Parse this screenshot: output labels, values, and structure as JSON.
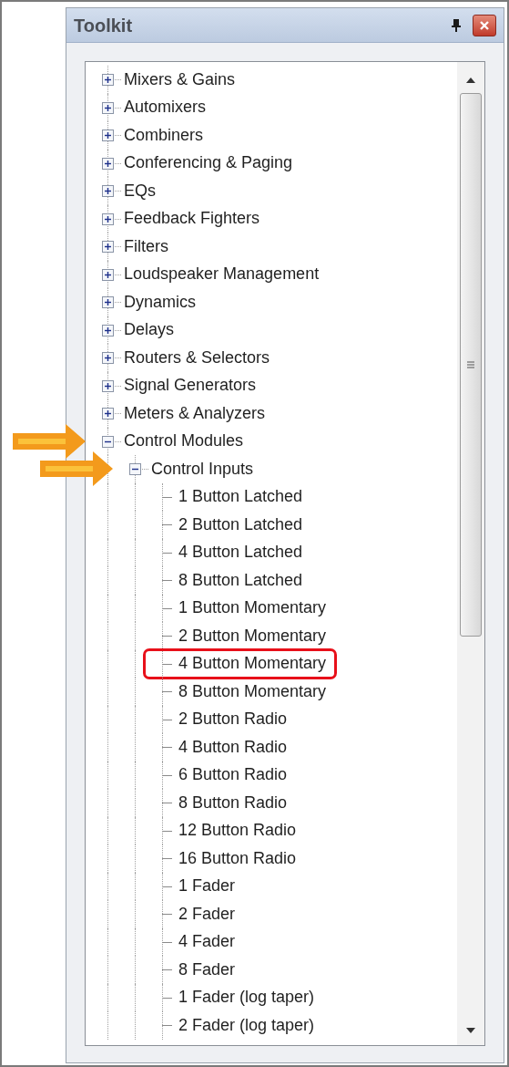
{
  "panel": {
    "title": "Toolkit"
  },
  "tree": [
    {
      "label": "Mixers & Gains",
      "expanded": false,
      "marked": false
    },
    {
      "label": "Automixers",
      "expanded": false,
      "marked": false
    },
    {
      "label": "Combiners",
      "expanded": false,
      "marked": false
    },
    {
      "label": "Conferencing & Paging",
      "expanded": false,
      "marked": false
    },
    {
      "label": "EQs",
      "expanded": false,
      "marked": false
    },
    {
      "label": "Feedback Fighters",
      "expanded": false,
      "marked": false
    },
    {
      "label": "Filters",
      "expanded": false,
      "marked": false
    },
    {
      "label": "Loudspeaker Management",
      "expanded": false,
      "marked": false
    },
    {
      "label": "Dynamics",
      "expanded": false,
      "marked": false
    },
    {
      "label": "Delays",
      "expanded": false,
      "marked": false
    },
    {
      "label": "Routers & Selectors",
      "expanded": false,
      "marked": false
    },
    {
      "label": "Signal Generators",
      "expanded": false,
      "marked": false
    },
    {
      "label": "Meters & Analyzers",
      "expanded": false,
      "marked": false
    },
    {
      "label": "Control Modules",
      "expanded": true,
      "marked": true,
      "children": [
        {
          "label": "Control Inputs",
          "expanded": true,
          "marked": true,
          "children": [
            {
              "label": "1 Button Latched",
              "highlighted": false
            },
            {
              "label": "2 Button Latched",
              "highlighted": false
            },
            {
              "label": "4 Button Latched",
              "highlighted": false
            },
            {
              "label": "8 Button Latched",
              "highlighted": false
            },
            {
              "label": "1 Button Momentary",
              "highlighted": false
            },
            {
              "label": "2 Button Momentary",
              "highlighted": false
            },
            {
              "label": "4 Button Momentary",
              "highlighted": true
            },
            {
              "label": "8 Button Momentary",
              "highlighted": false
            },
            {
              "label": "2 Button Radio",
              "highlighted": false
            },
            {
              "label": "4 Button Radio",
              "highlighted": false
            },
            {
              "label": "6 Button Radio",
              "highlighted": false
            },
            {
              "label": "8 Button Radio",
              "highlighted": false
            },
            {
              "label": "12 Button Radio",
              "highlighted": false
            },
            {
              "label": "16 Button Radio",
              "highlighted": false
            },
            {
              "label": "1 Fader",
              "highlighted": false
            },
            {
              "label": "2 Fader",
              "highlighted": false
            },
            {
              "label": "4 Fader",
              "highlighted": false
            },
            {
              "label": "8 Fader",
              "highlighted": false
            },
            {
              "label": "1 Fader (log taper)",
              "highlighted": false
            },
            {
              "label": "2 Fader (log taper)",
              "highlighted": false
            }
          ]
        }
      ]
    }
  ]
}
